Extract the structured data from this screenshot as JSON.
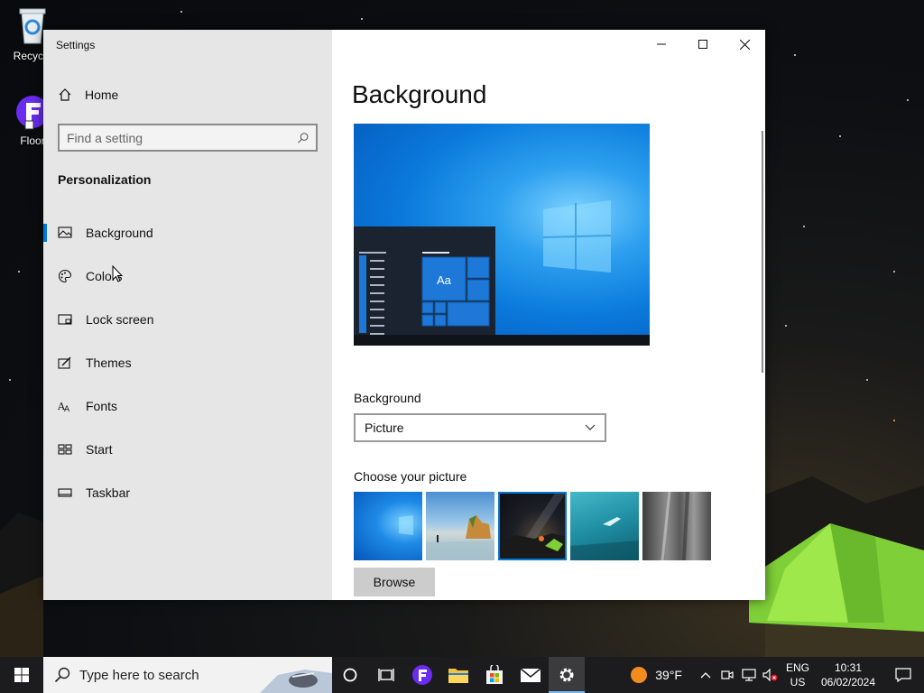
{
  "desktop": {
    "icons": [
      {
        "label": "Recycle"
      },
      {
        "label": "Floor"
      }
    ]
  },
  "window": {
    "title": "Settings",
    "sidebar": {
      "home_label": "Home",
      "search_placeholder": "Find a setting",
      "section_title": "Personalization",
      "items": [
        {
          "label": "Background",
          "icon": "picture-icon",
          "active": true
        },
        {
          "label": "Colors",
          "icon": "palette-icon"
        },
        {
          "label": "Lock screen",
          "icon": "lock-screen-icon"
        },
        {
          "label": "Themes",
          "icon": "themes-icon"
        },
        {
          "label": "Fonts",
          "icon": "fonts-icon"
        },
        {
          "label": "Start",
          "icon": "start-icon"
        },
        {
          "label": "Taskbar",
          "icon": "taskbar-icon"
        }
      ]
    },
    "content": {
      "page_title": "Background",
      "preview_text": "Aa",
      "background_label": "Background",
      "background_value": "Picture",
      "choose_label": "Choose your picture",
      "browse_label": "Browse"
    }
  },
  "taskbar": {
    "search_placeholder": "Type here to search",
    "weather": "39°F",
    "lang_line1": "ENG",
    "lang_line2": "US",
    "time": "10:31",
    "date": "06/02/2024"
  },
  "colors": {
    "accent": "#0078d7",
    "sidebar_bg": "#e6e6e6",
    "taskbar_bg": "#1c1c1e"
  }
}
